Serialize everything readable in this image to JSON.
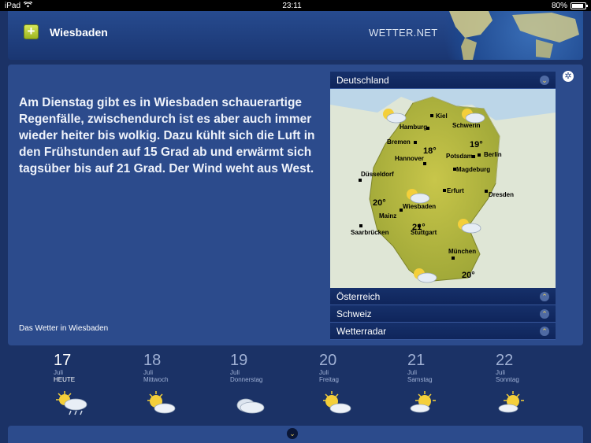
{
  "status": {
    "device": "iPad",
    "time": "23:11",
    "battery": "80%"
  },
  "header": {
    "add_label": "+",
    "city": "Wiesbaden",
    "brand": "WETTER.NET"
  },
  "forecast": {
    "text": "Am Dienstag gibt es in Wiesbaden schauerartige Regenfälle, zwischendurch ist es aber auch immer wieder heiter bis wolkig. Dazu kühlt sich die Luft in den Frühstunden auf 15 Grad ab und erwärmt sich tagsüber bis auf 21 Grad. Der Wind weht   aus West.",
    "link": "Das Wetter in Wiesbaden"
  },
  "map": {
    "region_selected": "Deutschland",
    "regions": [
      "Österreich",
      "Schweiz",
      "Wetterradar"
    ],
    "cities": {
      "kiel": "Kiel",
      "hamburg": "Hamburg",
      "schwerin": "Schwerin",
      "bremen": "Bremen",
      "hannover": "Hannover",
      "potsdam": "Potsdam",
      "berlin": "Berlin",
      "magdeburg": "Magdeburg",
      "duesseldorf": "Düsseldorf",
      "erfurt": "Erfurt",
      "dresden": "Dresden",
      "wiesbaden": "Wiesbaden",
      "mainz": "Mainz",
      "saarbruecken": "Saarbrücken",
      "stuttgart": "Stuttgart",
      "muenchen": "München"
    },
    "temps": {
      "t1": "18°",
      "t2": "19°",
      "t3": "20°",
      "t4": "21°",
      "t5": "20°"
    }
  },
  "days": [
    {
      "num": "17",
      "month": "Juli",
      "name": "HEUTE",
      "icon": "sun-cloud-rain-icon"
    },
    {
      "num": "18",
      "month": "Juli",
      "name": "Mittwoch",
      "icon": "sun-cloud-icon"
    },
    {
      "num": "19",
      "month": "Juli",
      "name": "Donnerstag",
      "icon": "cloud-icon"
    },
    {
      "num": "20",
      "month": "Juli",
      "name": "Freitag",
      "icon": "sun-cloud-icon"
    },
    {
      "num": "21",
      "month": "Juli",
      "name": "Samstag",
      "icon": "sun-cloud-icon"
    },
    {
      "num": "22",
      "month": "Juli",
      "name": "Sonntag",
      "icon": "sun-cloud-icon"
    }
  ],
  "colors": {
    "background": "#1b3266",
    "panel": "#2c4b8c",
    "accent": "#f0d25a"
  }
}
